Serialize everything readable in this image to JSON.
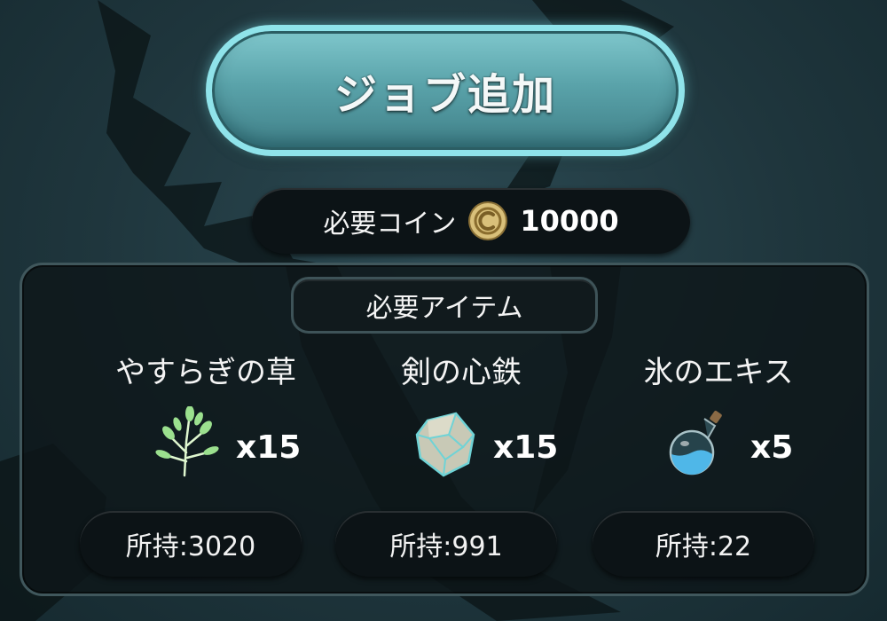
{
  "add_job_button": {
    "label": "ジョブ追加"
  },
  "coin_requirement": {
    "label": "必要コイン",
    "icon": "coin-icon",
    "value": "10000"
  },
  "required_items": {
    "title": "必要アイテム",
    "items": [
      {
        "name": "やすらぎの草",
        "icon": "herb-icon",
        "quantity": "x15",
        "owned": "所持:3020"
      },
      {
        "name": "剣の心鉄",
        "icon": "ore-stone-icon",
        "quantity": "x15",
        "owned": "所持:991"
      },
      {
        "name": "氷のエキス",
        "icon": "potion-flask-icon",
        "quantity": "x5",
        "owned": "所持:22"
      }
    ]
  },
  "colors": {
    "button_border": "#8fe3ea",
    "button_fill": "#5aa3aa",
    "panel_bg": "#0e1619",
    "pill_bg": "#0c1316"
  }
}
